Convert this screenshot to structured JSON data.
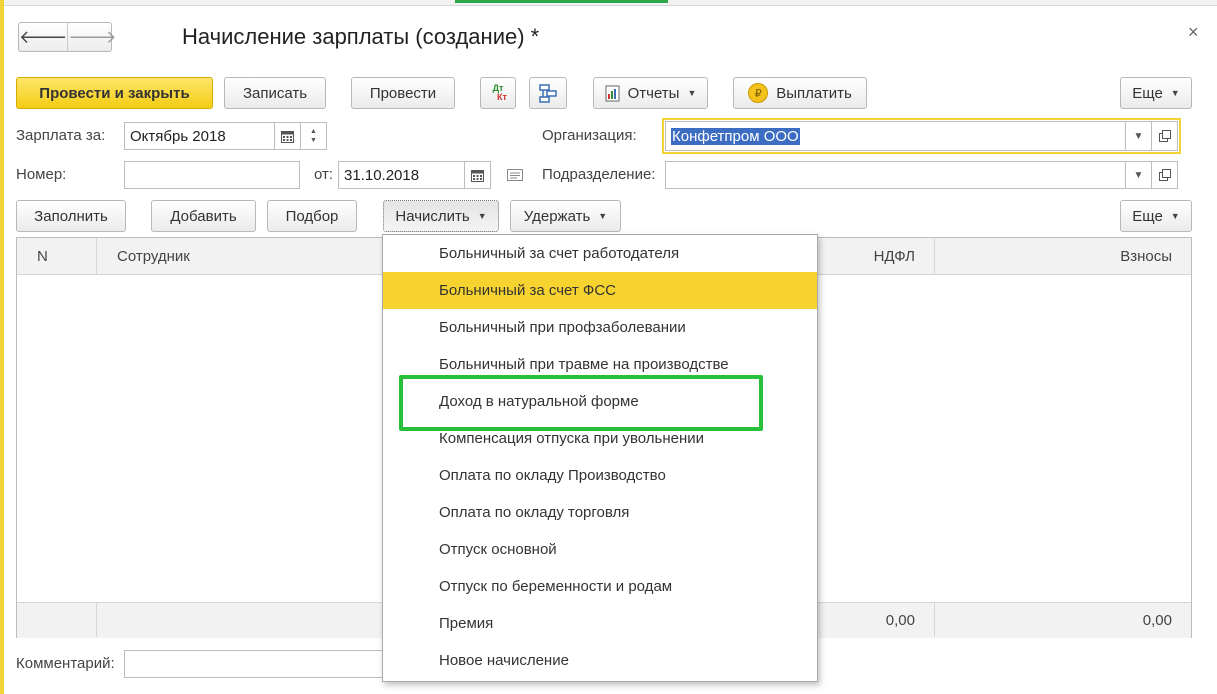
{
  "window": {
    "title": "Начисление зарплаты (создание) *",
    "close_glyph": "×"
  },
  "nav": {
    "back_glyph": "🡐",
    "forward_glyph": "🡒"
  },
  "toolbar": {
    "post_and_close": "Провести и закрыть",
    "save": "Записать",
    "post": "Провести",
    "dt_top": "Дт",
    "dt_bottom": "Кт",
    "reports": "Отчеты",
    "pay": "Выплатить",
    "pay_icon_glyph": "₽",
    "more": "Еще"
  },
  "form": {
    "salary_for_label": "Зарплата за:",
    "salary_for_value": "Октябрь 2018",
    "number_label": "Номер:",
    "number_value": "",
    "date_label": "от:",
    "date_value": "31.10.2018",
    "organization_label": "Организация:",
    "organization_value": "Конфетпром ООО",
    "department_label": "Подразделение:",
    "department_value": "",
    "comment_label": "Комментарий:",
    "comment_value": ""
  },
  "table_toolbar": {
    "fill": "Заполнить",
    "add": "Добавить",
    "pick": "Подбор",
    "accrue": "Начислить",
    "withhold": "Удержать",
    "more": "Еще"
  },
  "table": {
    "columns": [
      "N",
      "Сотрудник",
      "НДФЛ",
      "Взносы"
    ],
    "rows": [],
    "footer": {
      "ndfl_total": "0,00",
      "contributions_total": "0,00"
    }
  },
  "accrue_menu": {
    "items": [
      "Больничный за счет работодателя",
      "Больничный за счет ФСС",
      "Больничный при профзаболевании",
      "Больничный при травме на производстве",
      "Доход в натуральной форме",
      "Компенсация отпуска при увольнении",
      "Оплата по окладу Производство",
      "Оплата по окладу торговля",
      "Отпуск основной",
      "Отпуск по беременности и родам",
      "Премия",
      "Новое начисление"
    ],
    "highlighted_item": "Больничный за счет ФСС",
    "outlined_item": "Доход в натуральной форме"
  },
  "colors": {
    "accent_yellow": "#f6d32e",
    "highlight_green": "#27c038",
    "selection_blue": "#3d6cc3"
  },
  "icons": [
    "back-arrow-icon",
    "forward-arrow-icon",
    "close-icon",
    "dt-kt-icon",
    "structure-icon",
    "report-icon",
    "ruble-coin-icon",
    "calendar-icon",
    "spinner-icon",
    "history-icon",
    "open-icon"
  ]
}
